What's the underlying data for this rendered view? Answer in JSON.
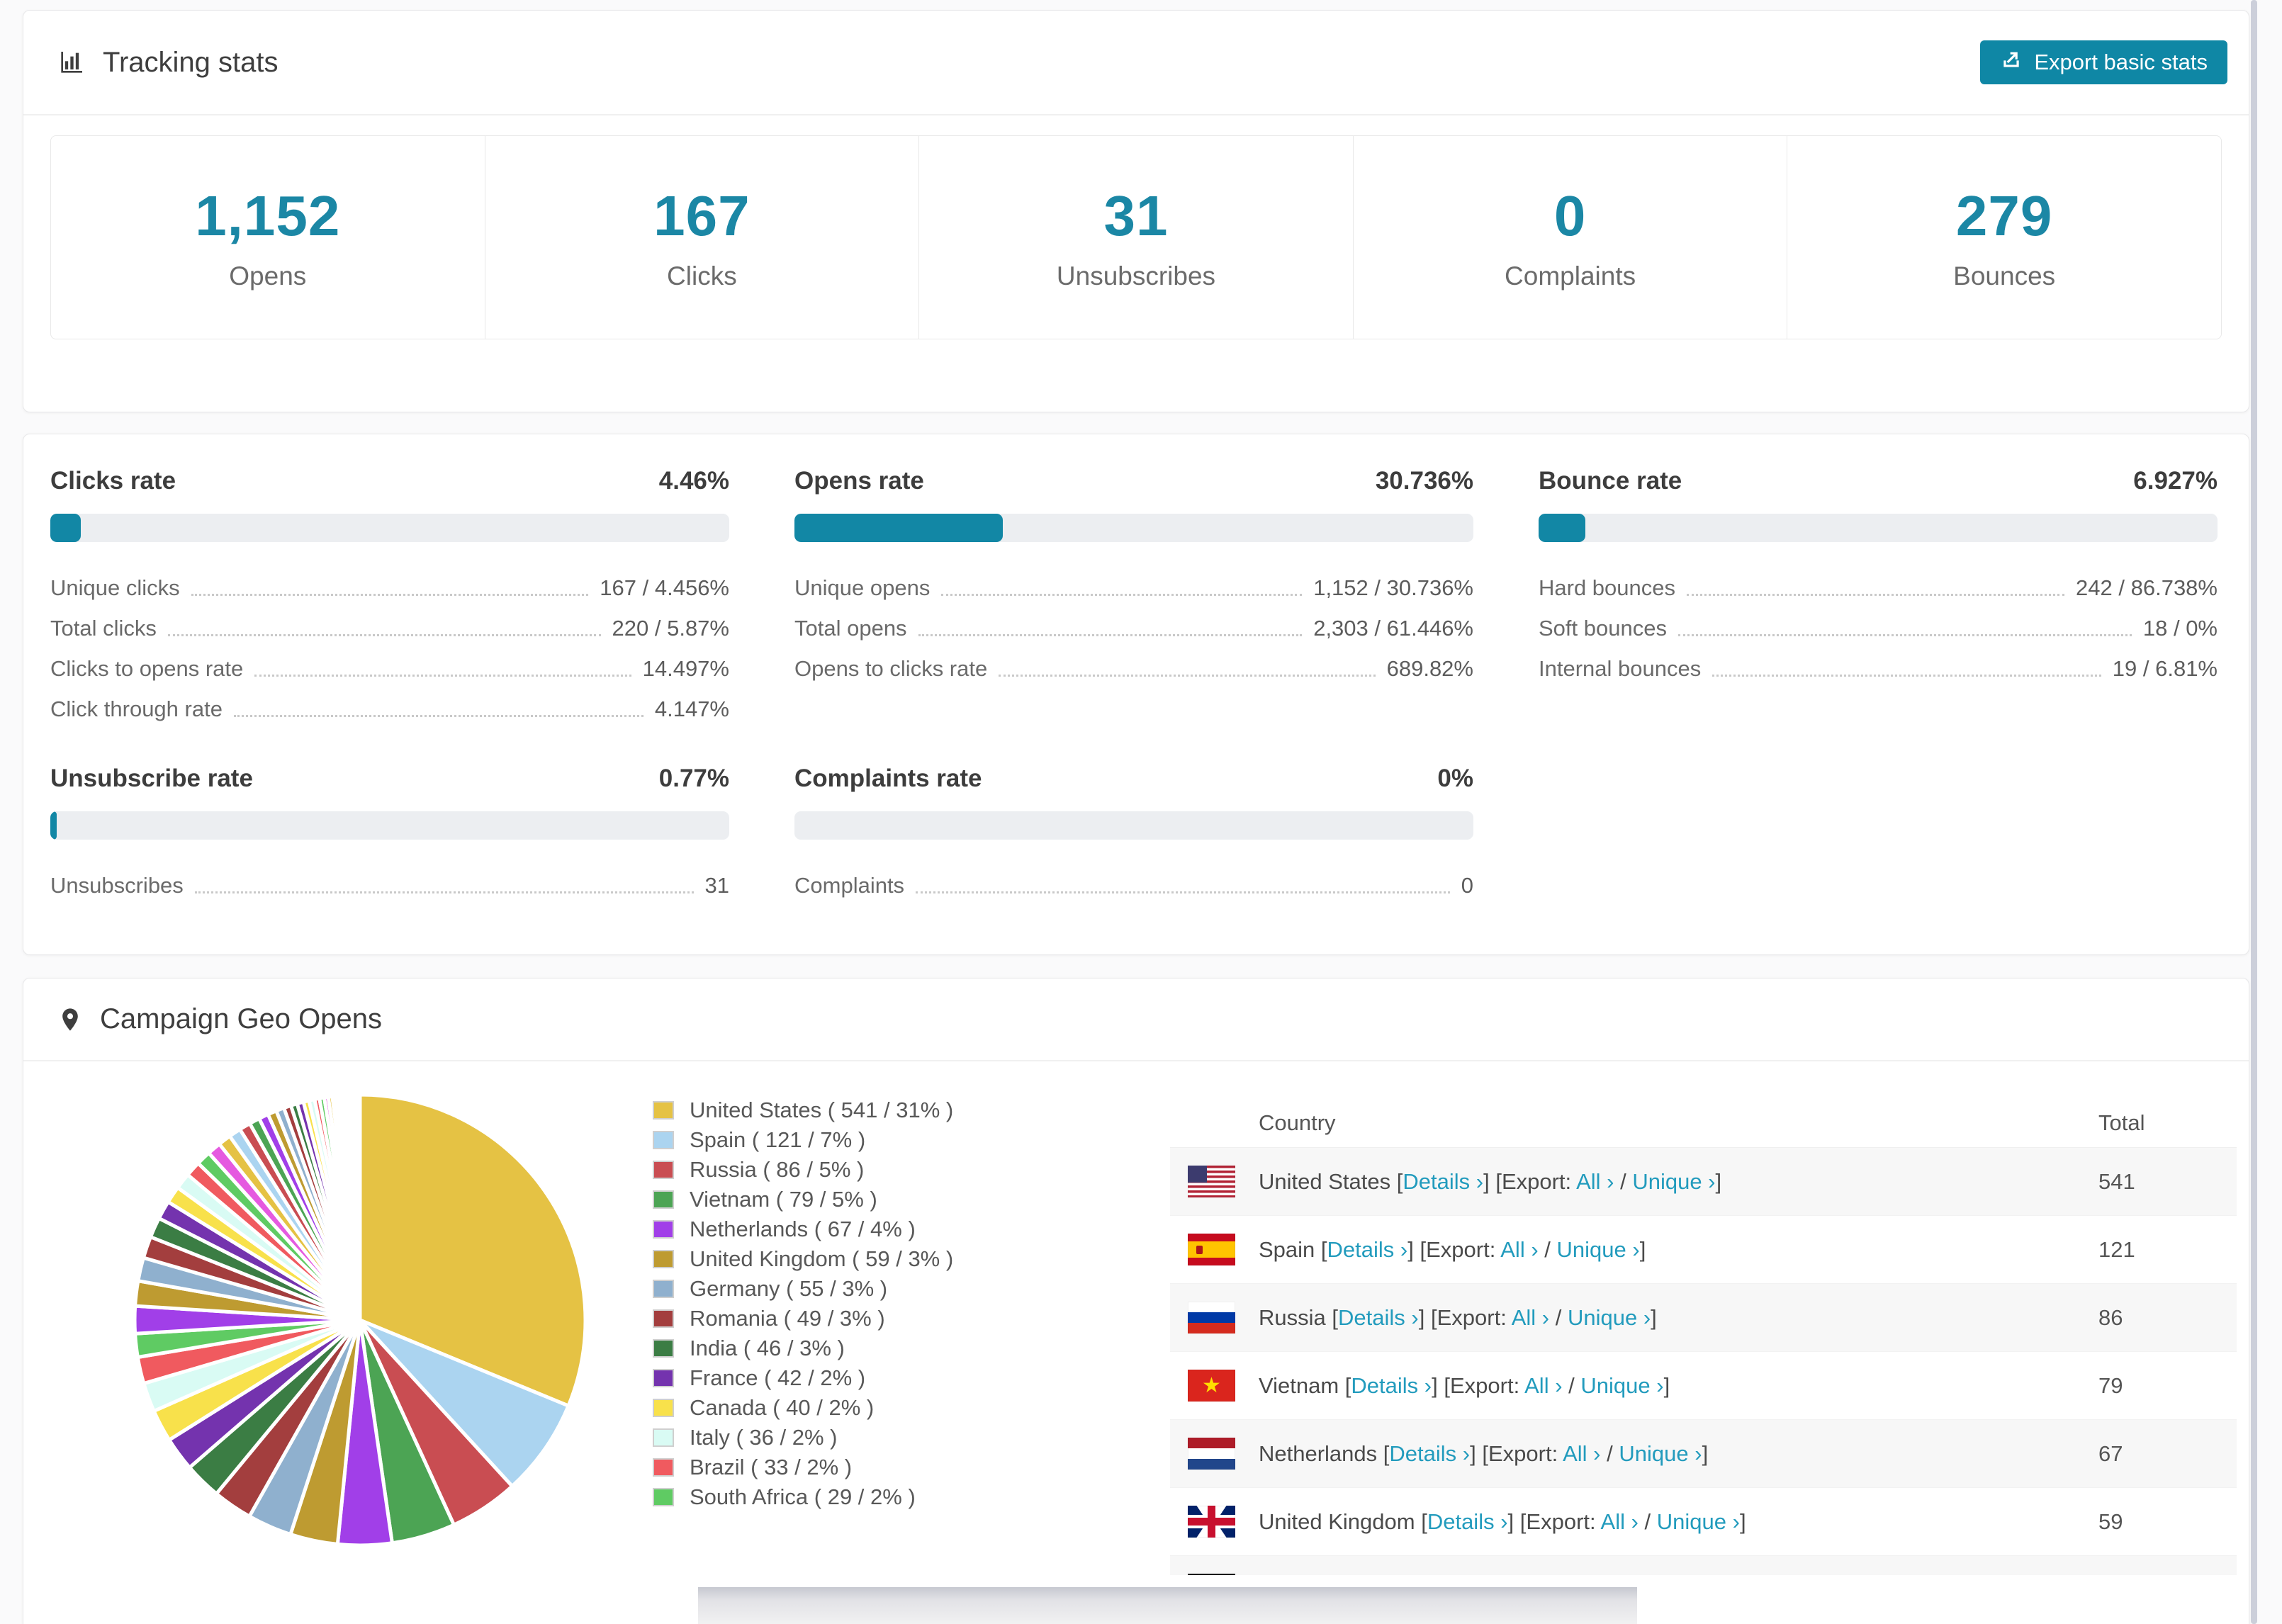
{
  "colors": {
    "accent": "#1287A5",
    "stat_number": "#1B87A5",
    "link": "#229BBD",
    "progress_track": "#ECEEF1",
    "row_alt": "#F7F7F7",
    "title_text": "#3E3E3E"
  },
  "tracking": {
    "title": "Tracking stats",
    "export_label": "Export basic stats",
    "summary": [
      {
        "value": "1,152",
        "label": "Opens"
      },
      {
        "value": "167",
        "label": "Clicks"
      },
      {
        "value": "31",
        "label": "Unsubscribes"
      },
      {
        "value": "0",
        "label": "Complaints"
      },
      {
        "value": "279",
        "label": "Bounces"
      }
    ]
  },
  "rates": [
    {
      "title": "Clicks rate",
      "value": "4.46%",
      "percent": 4.46,
      "rows": [
        {
          "label": "Unique clicks",
          "value": "167 / 4.456%"
        },
        {
          "label": "Total clicks",
          "value": "220 / 5.87%"
        },
        {
          "label": "Clicks to opens rate",
          "value": "14.497%"
        },
        {
          "label": "Click through rate",
          "value": "4.147%"
        }
      ]
    },
    {
      "title": "Opens rate",
      "value": "30.736%",
      "percent": 30.736,
      "rows": [
        {
          "label": "Unique opens",
          "value": "1,152 / 30.736%"
        },
        {
          "label": "Total opens",
          "value": "2,303 / 61.446%"
        },
        {
          "label": "Opens to clicks rate",
          "value": "689.82%"
        }
      ]
    },
    {
      "title": "Bounce rate",
      "value": "6.927%",
      "percent": 6.927,
      "rows": [
        {
          "label": "Hard bounces",
          "value": "242 / 86.738%"
        },
        {
          "label": "Soft bounces",
          "value": "18 / 0%"
        },
        {
          "label": "Internal bounces",
          "value": "19 / 6.81%"
        }
      ]
    },
    {
      "title": "Unsubscribe rate",
      "value": "0.77%",
      "percent": 0.77,
      "rows": [
        {
          "label": "Unsubscribes",
          "value": "31"
        }
      ]
    },
    {
      "title": "Complaints rate",
      "value": "0%",
      "percent": 0,
      "rows": [
        {
          "label": "Complaints",
          "value": "0"
        }
      ]
    }
  ],
  "geo": {
    "title": "Campaign Geo Opens",
    "table": {
      "headers": [
        "Country",
        "Total"
      ],
      "syntax": {
        "ob": "[",
        "cb": "]",
        "slash": "/"
      },
      "links": {
        "details": "Details ›",
        "export_prefix": "Export:",
        "all": "All ›",
        "unique": "Unique ›"
      },
      "rows": [
        {
          "country": "United States",
          "flag": "us",
          "total": "541"
        },
        {
          "country": "Spain",
          "flag": "es",
          "total": "121"
        },
        {
          "country": "Russia",
          "flag": "ru",
          "total": "86"
        },
        {
          "country": "Vietnam",
          "flag": "vn",
          "total": "79"
        },
        {
          "country": "Netherlands",
          "flag": "nl",
          "total": "67"
        },
        {
          "country": "United Kingdom",
          "flag": "gb",
          "total": "59"
        },
        {
          "country": "",
          "flag": "de",
          "total": "",
          "partial": true
        }
      ]
    }
  },
  "chart_data": {
    "type": "pie",
    "title": "Campaign Geo Opens",
    "unit": "opens",
    "legend_position": "right-of-chart",
    "start_angle_deg": 0,
    "direction": "clockwise",
    "labels": [
      "United States",
      "Spain",
      "Russia",
      "Vietnam",
      "Netherlands",
      "United Kingdom",
      "Germany",
      "Romania",
      "India",
      "France",
      "Canada",
      "Italy",
      "Brazil",
      "South Africa"
    ],
    "values": [
      541,
      121,
      86,
      79,
      67,
      59,
      55,
      49,
      46,
      42,
      40,
      36,
      33,
      29
    ],
    "pct_labels": [
      "31%",
      "7%",
      "5%",
      "5%",
      "4%",
      "3%",
      "3%",
      "3%",
      "3%",
      "2%",
      "2%",
      "2%",
      "2%",
      "2%"
    ],
    "colors": [
      "#E5C244",
      "#ABD4F0",
      "#C94D52",
      "#4CA454",
      "#A13FE8",
      "#BE9B31",
      "#8FB0CE",
      "#A33E3E",
      "#3B7D44",
      "#7433AE",
      "#F8E14B",
      "#D9FBF4",
      "#F05A5F",
      "#5FCB63"
    ],
    "small_slices_approx": {
      "note": "many unlabeled small-country slices tapering toward 12 o'clock",
      "values": [
        34,
        31,
        29,
        27,
        25,
        23,
        21,
        20,
        19,
        18,
        17,
        16,
        15,
        14,
        13,
        12,
        11,
        10,
        9,
        8,
        8,
        7,
        7,
        6,
        6,
        5,
        5,
        4,
        4,
        3,
        3,
        3,
        2,
        2,
        2,
        2,
        1,
        1,
        1,
        1,
        1,
        1,
        1,
        1,
        1
      ],
      "colors_cycle": [
        "#A13FE8",
        "#BE9B31",
        "#8FB0CE",
        "#A33E3E",
        "#3B7D44",
        "#7433AE",
        "#F8E14B",
        "#D9FBF4",
        "#F05A5F",
        "#5FCB63",
        "#E55AE0",
        "#E5C244",
        "#ABD4F0",
        "#C94D52",
        "#4CA454"
      ]
    }
  }
}
